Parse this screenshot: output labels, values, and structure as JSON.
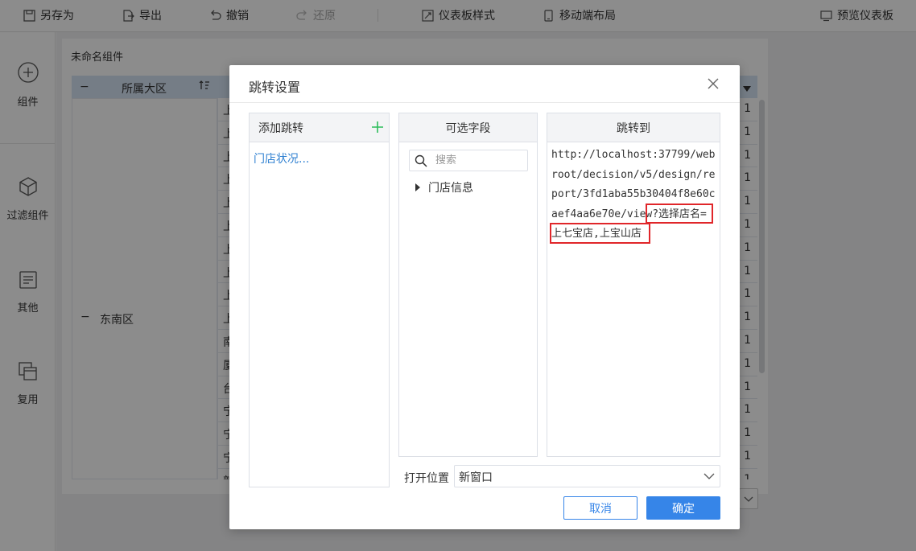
{
  "toolbar": {
    "save_as": "另存为",
    "export": "导出",
    "undo": "撤销",
    "redo": "还原",
    "dashboard_style": "仪表板样式",
    "mobile_layout": "移动端布局",
    "preview": "预览仪表板"
  },
  "sidebar": {
    "items": [
      {
        "label": "组件",
        "icon": "plus-circle-icon"
      },
      {
        "label": "过滤组件",
        "icon": "cube-icon"
      },
      {
        "label": "其他",
        "icon": "document-icon"
      },
      {
        "label": "复用",
        "icon": "copy-icon"
      }
    ]
  },
  "widget": {
    "title": "未命名组件",
    "header": {
      "collapse": "−",
      "region_col": "所属大区"
    },
    "region_group": "东南区",
    "row_first_chars": [
      "上",
      "上",
      "上",
      "上",
      "上",
      "上",
      "上",
      "上",
      "上",
      "上",
      "南",
      "厦",
      "台",
      "宁",
      "宁",
      "宁",
      "新"
    ],
    "row_last_values": [
      "1",
      "1",
      "1",
      "1",
      "1",
      "1",
      "1",
      "1",
      "1",
      "1",
      "1",
      "1",
      "1",
      "1",
      "1",
      "1",
      "1"
    ]
  },
  "dialog": {
    "title": "跳转设置",
    "add_jump": {
      "header": "添加跳转",
      "items": [
        "门店状况..."
      ]
    },
    "fields": {
      "header": "可选字段",
      "search_placeholder": "搜索",
      "tree": [
        "门店信息"
      ]
    },
    "jump_to": {
      "header": "跳转到",
      "url": "http://localhost:37799/webroot/decision/v5/design/report/3fd1aba55b30404f8e60caef4aa6e70e/view?选择店名=上七宝店,上宝山店"
    },
    "open_position": {
      "label": "打开位置",
      "value": "新窗口"
    },
    "cancel": "取消",
    "ok": "确定"
  },
  "colors": {
    "primary": "#3685e8",
    "highlight": "#e0262a",
    "link": "#2f80d1",
    "add_green": "#2dbd5a"
  }
}
